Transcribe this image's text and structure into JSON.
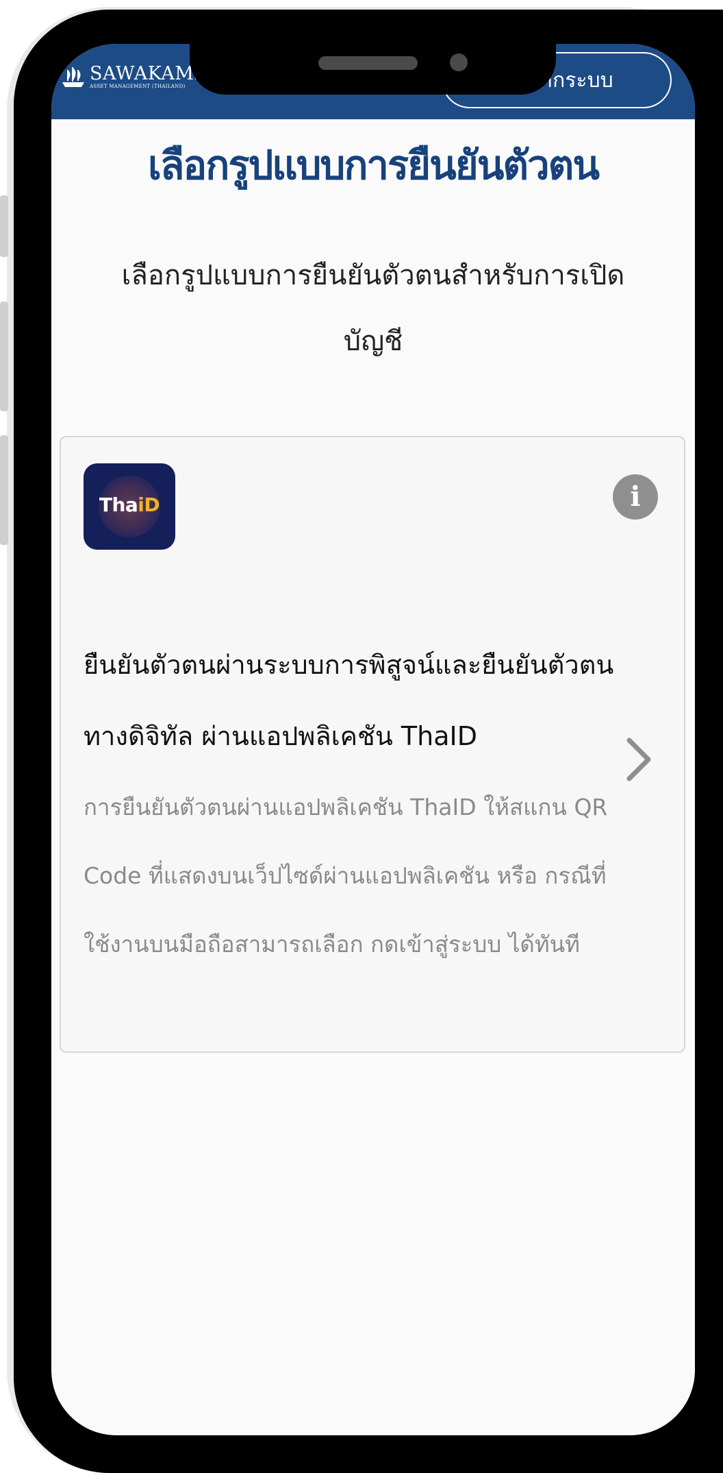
{
  "header": {
    "brand_name": "SAWAKAMI",
    "brand_subtitle": "ASSET MANAGEMENT (THAILAND)",
    "login_label": "ากระบบ"
  },
  "page": {
    "title": "เลือกรูปแบบการยืนยันตัวตน",
    "subtitle": "เลือกรูปแบบการยืนยันตัวตนสำหรับการเปิดบัญชี"
  },
  "card": {
    "icon_text_prefix": "Tha",
    "icon_text_suffix": "iD",
    "info_label": "i",
    "title": "ยืนยันตัวตนผ่านระบบการพิสูจน์และยืนยันตัวตนทางดิจิทัล ผ่านแอปพลิเคชัน ThaID",
    "description": "การยืนยันตัวตนผ่านแอปพลิเคชัน ThaID ให้สแกน QR Code ที่แสดงบนเว็ปไซด์ผ่านแอปพลิเคชัน หรือ กรณีที่ใช้งานบนมือถือสามารถเลือก กดเข้าสู่ระบบ ได้ทันที"
  },
  "colors": {
    "header_bg": "#1d4b86",
    "title_color": "#17427c",
    "thaid_bg": "#15205b",
    "thaid_accent": "#f0b323"
  }
}
